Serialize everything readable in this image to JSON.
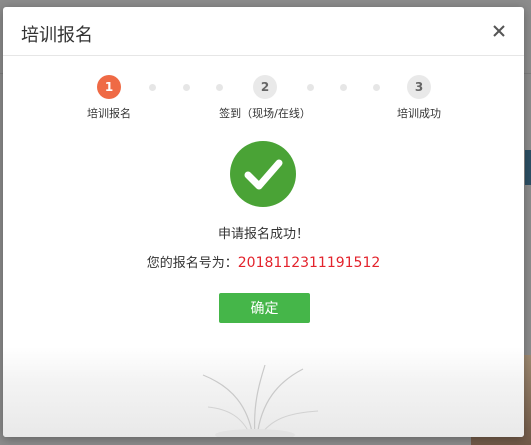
{
  "dialog": {
    "title": "培训报名",
    "close_label": "×"
  },
  "steps": [
    {
      "number": "1",
      "label": "培训报名",
      "state": "active"
    },
    {
      "number": "2",
      "label": "签到（现场/在线）",
      "state": "inactive"
    },
    {
      "number": "3",
      "label": "培训成功",
      "state": "inactive"
    }
  ],
  "result": {
    "message": "申请报名成功！",
    "number_label": "您的报名号为：",
    "number_value": "2018112311191512"
  },
  "confirm_button": "确定",
  "colors": {
    "accent_orange": "#ef6a45",
    "success_green": "#4aa336",
    "button_green": "#45b649",
    "number_red": "#e3232c"
  }
}
